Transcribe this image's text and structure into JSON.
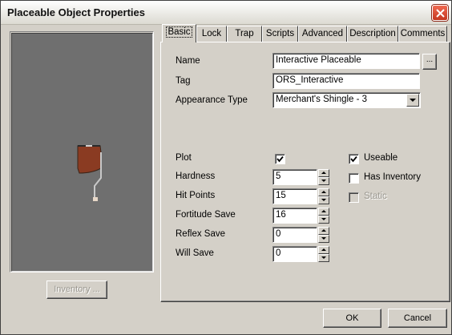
{
  "window": {
    "title": "Placeable Object Properties",
    "close_icon": "close-icon"
  },
  "left": {
    "inventory_label": "Inventory ..."
  },
  "tabs": [
    {
      "label": "Basic",
      "active": true
    },
    {
      "label": "Lock",
      "active": false
    },
    {
      "label": "Trap",
      "active": false
    },
    {
      "label": "Scripts",
      "active": false
    },
    {
      "label": "Advanced",
      "active": false
    },
    {
      "label": "Description",
      "active": false
    },
    {
      "label": "Comments",
      "active": false
    }
  ],
  "basic": {
    "name_label": "Name",
    "name_value": "Interactive Placeable",
    "browse_label": "...",
    "tag_label": "Tag",
    "tag_value": "ORS_Interactive",
    "appearance_label": "Appearance Type",
    "appearance_value": "Merchant's Shingle - 3",
    "plot_label": "Plot",
    "plot_checked": true,
    "hardness_label": "Hardness",
    "hardness_value": "5",
    "hitpoints_label": "Hit Points",
    "hitpoints_value": "15",
    "fortitude_label": "Fortitude Save",
    "fortitude_value": "16",
    "reflex_label": "Reflex Save",
    "reflex_value": "0",
    "will_label": "Will Save",
    "will_value": "0",
    "useable_label": "Useable",
    "useable_checked": true,
    "has_inventory_label": "Has Inventory",
    "has_inventory_checked": false,
    "static_label": "Static",
    "static_checked": false,
    "static_enabled": false
  },
  "footer": {
    "ok_label": "OK",
    "cancel_label": "Cancel"
  },
  "colors": {
    "dialog_bg": "#d4d0c8",
    "preview_bg": "#6f6f6f",
    "close_red": "#d9462d"
  }
}
